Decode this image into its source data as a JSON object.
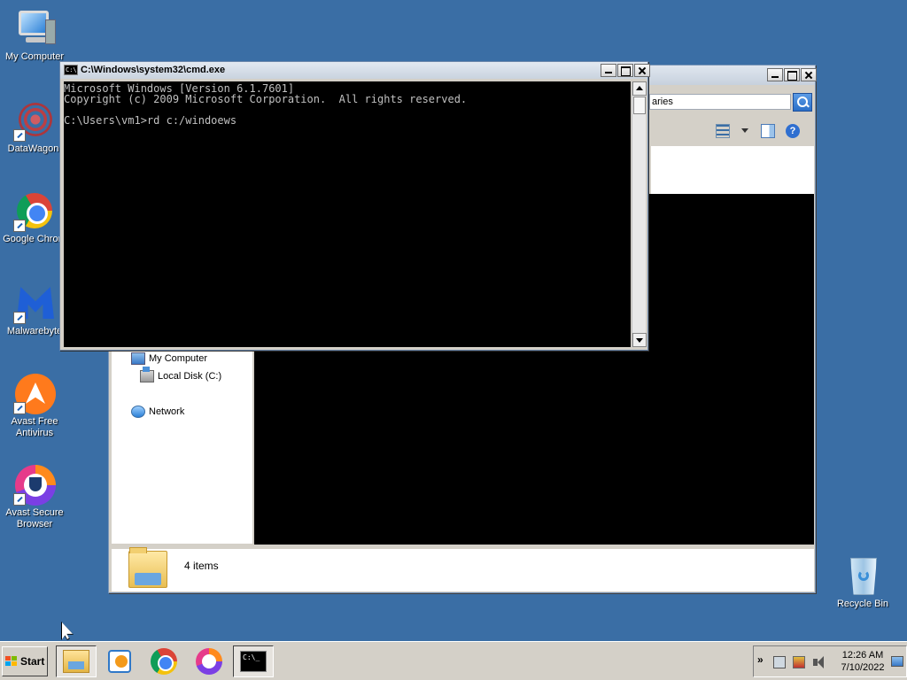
{
  "desktop": {
    "icons": [
      {
        "label": "My Computer",
        "icon": "computer-icon"
      },
      {
        "label": "DataWagon.",
        "icon": "datawagon-icon"
      },
      {
        "label": "Google Chrom",
        "icon": "chrome-icon"
      },
      {
        "label": "Malwarebyte",
        "icon": "malwarebytes-icon"
      },
      {
        "label_line1": "Avast Free",
        "label_line2": "Antivirus",
        "icon": "avast-icon"
      },
      {
        "label_line1": "Avast Secure",
        "label_line2": "Browser",
        "icon": "avast-secure-browser-icon"
      },
      {
        "label": "Recycle Bin",
        "icon": "recycle-bin-icon"
      }
    ]
  },
  "explorer": {
    "search_value": "aries",
    "nav": {
      "my_computer": "My Computer",
      "local_disk": "Local Disk (C:)",
      "network": "Network"
    },
    "status": "4 items"
  },
  "cmd": {
    "title": "C:\\Windows\\system32\\cmd.exe",
    "icon_text": "C:\\",
    "lines": [
      "Microsoft Windows [Version 6.1.7601]",
      "Copyright (c) 2009 Microsoft Corporation.  All rights reserved.",
      "",
      "C:\\Users\\vm1>rd c:/windoews"
    ]
  },
  "taskbar": {
    "start_label": "Start",
    "cmd_icon_text": "C:\\_",
    "apps": [
      "windows-explorer-icon",
      "media-player-icon",
      "chrome-icon",
      "avast-secure-browser-icon",
      "command-prompt-icon"
    ],
    "tray_chevron": "»",
    "time": "12:26 AM",
    "date": "7/10/2022"
  },
  "colors": {
    "desktop_bg": "#3a6ea5",
    "console_bg": "#000000",
    "console_fg": "#c0c0c0"
  }
}
